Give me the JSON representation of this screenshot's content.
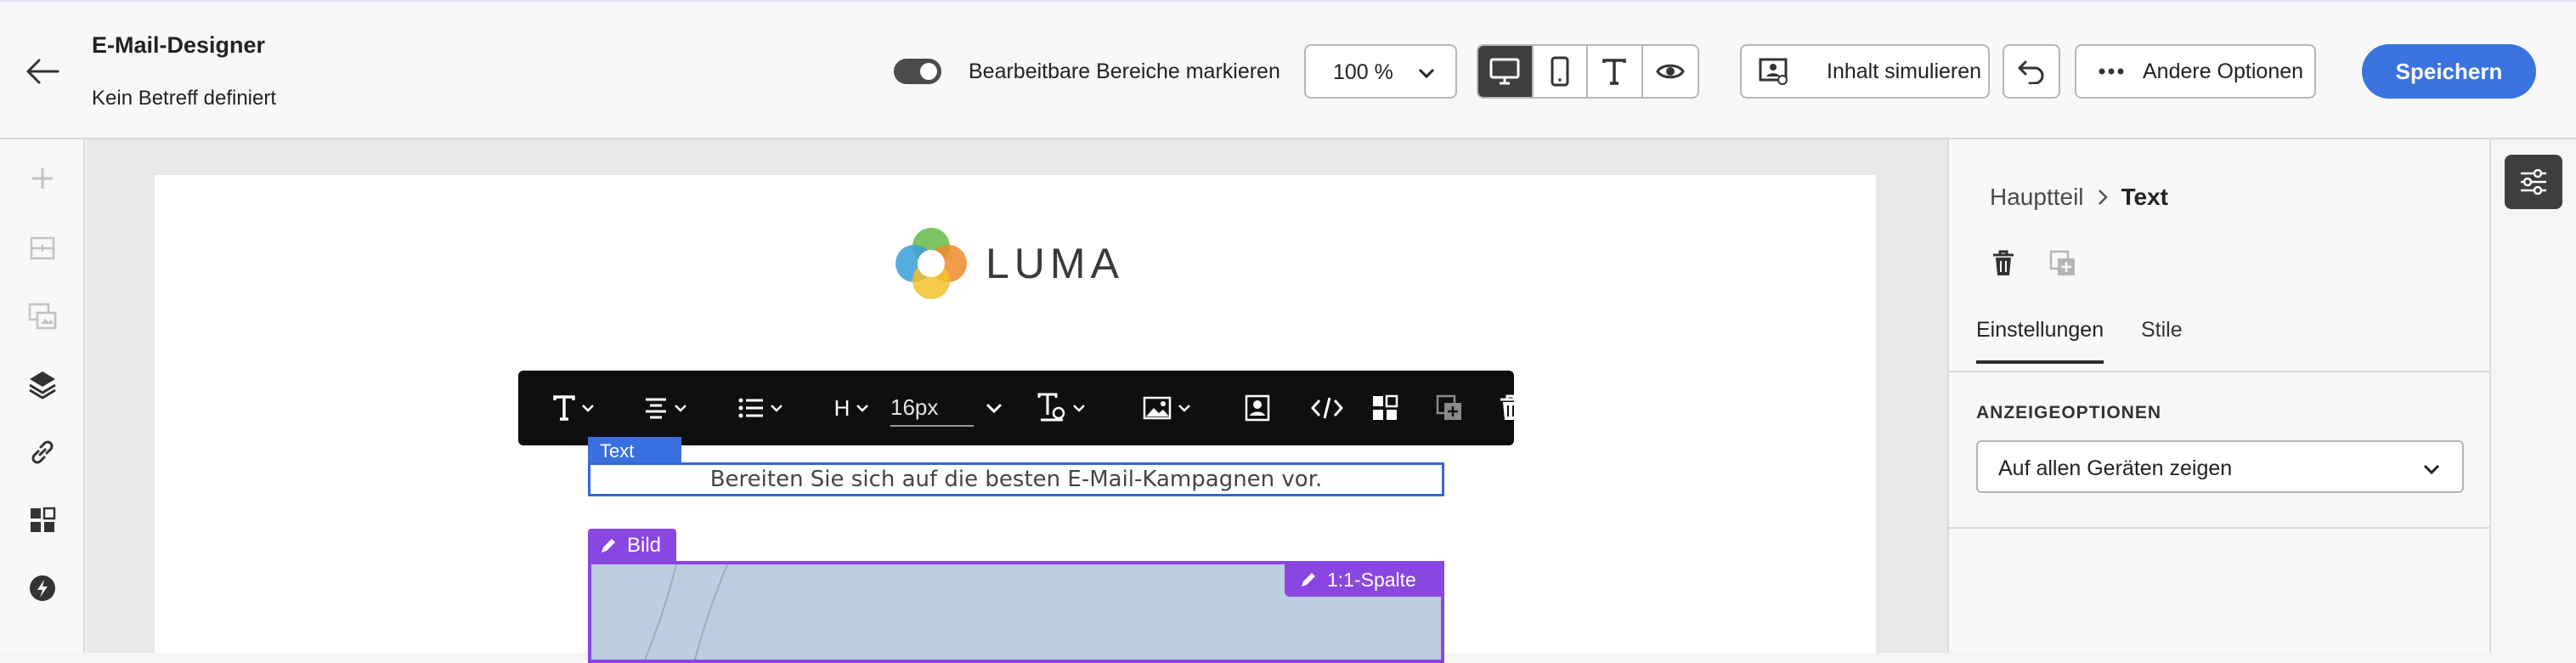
{
  "header": {
    "title": "E-Mail-Designer",
    "subject": "Kein Betreff definiert",
    "toggle_label": "Bearbeitbare Bereiche markieren",
    "toggle_on": true,
    "zoom": "100 %",
    "view_modes": [
      "desktop-icon",
      "mobile-icon",
      "text-icon",
      "eye-icon"
    ],
    "active_view": "desktop",
    "simulate_label": "Inhalt simulieren",
    "more_label": "Andere Optionen",
    "save_label": "Speichern",
    "save_color": "#3b73e0"
  },
  "left_rail": [
    "plus-icon",
    "structure-icon",
    "fragments-icon",
    "layers-icon",
    "link-icon",
    "components-icon",
    "bolt-icon"
  ],
  "canvas": {
    "logo_text": "LUMA",
    "toolbar": {
      "font_size": "16px",
      "heading_label": "H"
    },
    "text_tag": "Text",
    "text_content": "Bereiten Sie sich auf die besten E-Mail-Kampagnen vor.",
    "image_tag": "Bild",
    "column_tag": "1:1-Spalte",
    "selection_color": "#3a6fe0",
    "structure_color": "#8a46e0"
  },
  "panel": {
    "breadcrumb_parent": "Hauptteil",
    "breadcrumb_current": "Text",
    "tabs": [
      {
        "label": "Einstellungen",
        "active": true
      },
      {
        "label": "Stile",
        "active": false
      }
    ],
    "section_label": "ANZEIGEOPTIONEN",
    "visibility_value": "Auf allen Geräten zeigen"
  }
}
